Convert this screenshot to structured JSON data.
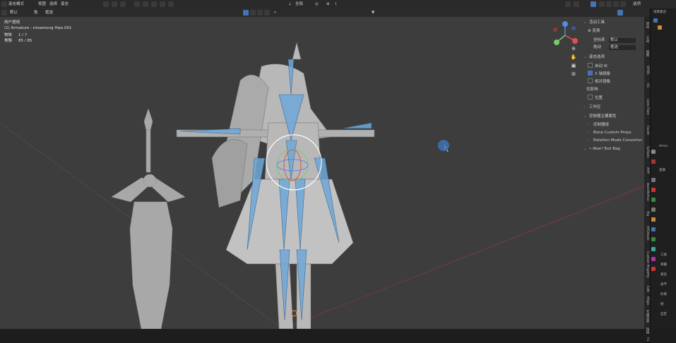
{
  "topbar": {
    "mode": "姿态模式",
    "menu_view": "视图",
    "menu_select": "选择",
    "menu_pose": "姿态",
    "transform_orientation": "全局",
    "right_label": "选项"
  },
  "subbar": {
    "orientation_value": "默认",
    "drag_label": "拖",
    "select_mode": "框选"
  },
  "stats": {
    "view_name": "用户透视",
    "armature_line": "(1) Armature : misamong Hips.001",
    "objects_label": "物体",
    "objects_value": "1 / 7",
    "bones_label": "骨骼",
    "bones_value": "85 / 85"
  },
  "npanel": {
    "active_tool": "活动工具",
    "tool_name": "变换",
    "orientation_label": "坐标系",
    "orientation_value": "默认",
    "drag_label": "拖动",
    "drag_value": "框选",
    "pose_options": "姿态选项",
    "auto_ik": "自动 IK",
    "x_mirror": "X 轴镜像",
    "relative_mirror": "相对镜像",
    "affect_only": "仅影响",
    "locations": "位置",
    "workspace": "工作区",
    "rig_main": "控制器主要属性",
    "rig_item1": "控制器组",
    "rig_item2": "Bone Custom Props",
    "rig_item3": "Rotation Mode Convertor",
    "rig_item4": "Akari Tool Bag"
  },
  "vtabs": [
    "项目",
    "工具",
    "视图",
    "SPDO",
    "KS",
    "Lens Flare",
    "Faceit",
    "SoTools",
    "ARP",
    "BoneRefine",
    "Rig",
    "VRQtools",
    "Custom Property",
    "Edit",
    "HOps",
    "卡通渲染",
    "快捷",
    "Fx"
  ],
  "rightpanel": {
    "rows": [
      "场景集合",
      "",
      "",
      "",
      "",
      "",
      "",
      "",
      "Arma",
      "变换",
      "",
      "工具",
      "骨骼",
      "姿态",
      "关节",
      "约束",
      "组",
      "自定"
    ]
  },
  "colors": {
    "viewport_bg": "#3d3d3d",
    "bone_blue": "#5aa7e0",
    "accent": "#4772b3",
    "mesh_gray": "#a8a8a8"
  }
}
